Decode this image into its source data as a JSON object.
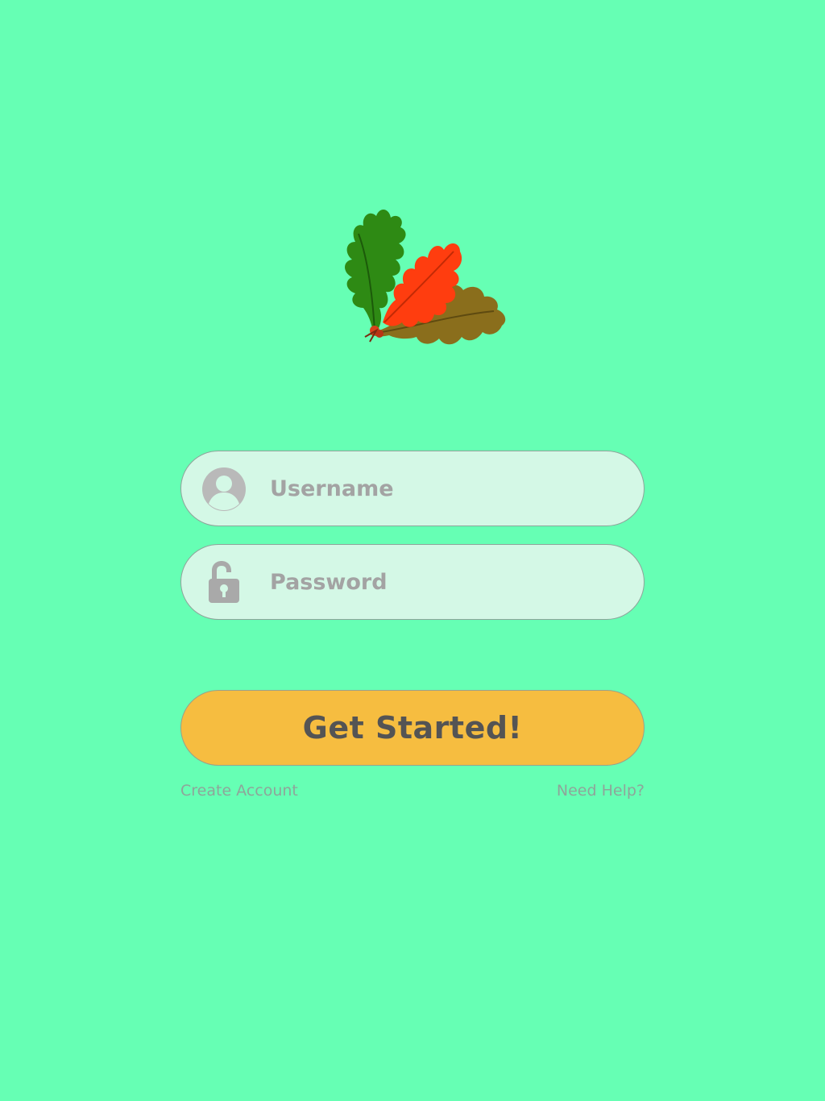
{
  "login": {
    "logo_icon": "oak-leaves-logo",
    "username": {
      "icon": "user-avatar-icon",
      "placeholder": "Username",
      "value": ""
    },
    "password": {
      "icon": "unlocked-padlock-icon",
      "placeholder": "Password",
      "value": ""
    },
    "submit_label": "Get Started!",
    "create_account_label": "Create Account",
    "help_label": "Need Help?"
  },
  "colors": {
    "background": "#66ffb4",
    "field_fill": "#d4f8e6",
    "button_fill": "#f6bd40",
    "leaf_green": "#2e8a14",
    "leaf_red": "#ff3d0f",
    "leaf_brown": "#8a6e1c"
  }
}
